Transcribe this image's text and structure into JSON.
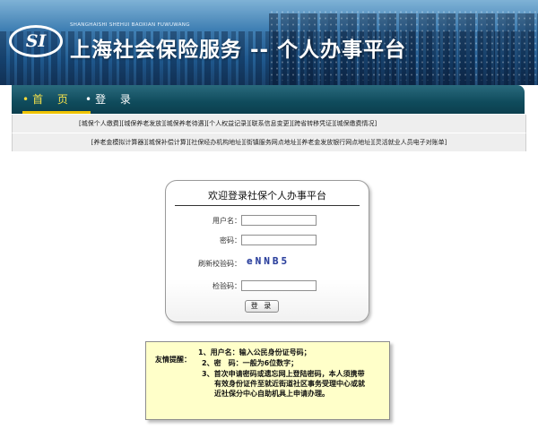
{
  "header": {
    "logo_text": "SI",
    "subtitle": "SHANGHAISHI SHEHUI BAOXIAN FUWUWANG",
    "title": "上海社会保险服务 -- 个人办事平台"
  },
  "nav": {
    "home": "首 页",
    "login": "登 录"
  },
  "links_row1": [
    "城保个人缴费",
    "城保养老发放",
    "城保养老待遇",
    "个人权益记录",
    "联系信息变更",
    "跨省转移凭证",
    "城保缴费情况"
  ],
  "links_row2": [
    "养老金模拟计算器",
    "城保补偿计算",
    "社保经办机构地址",
    "街镇服务网点地址",
    "养老金发放银行网点地址",
    "灵活就业人员电子对账单"
  ],
  "login": {
    "title": "欢迎登录社保个人办事平台",
    "username_label": "用户名：",
    "password_label": "密码：",
    "refresh_captcha_label": "刷新校验码：",
    "captcha_text": "eNNB5",
    "verify_label": "检验码：",
    "username_value": "",
    "password_value": "",
    "verify_value": "",
    "button": "登 录"
  },
  "notice": {
    "label": "友情提醒：",
    "item1": "1、用户名：输入公民身份证号码；",
    "item2": "2、密　码：一般为6位数字；",
    "item3_line1": "3、首次申请密码或遗忘网上登陆密码，本人须携带",
    "item3_line2": "有效身份证件至就近街道社区事务受理中心或就",
    "item3_line3": "近社保分中心自助机具上申请办理。"
  },
  "colors": {
    "nav_bg": "#0f4b5c",
    "nav_active": "#f6e24a",
    "notice_bg": "#ffffc9",
    "captcha": "#2b3f9a"
  }
}
